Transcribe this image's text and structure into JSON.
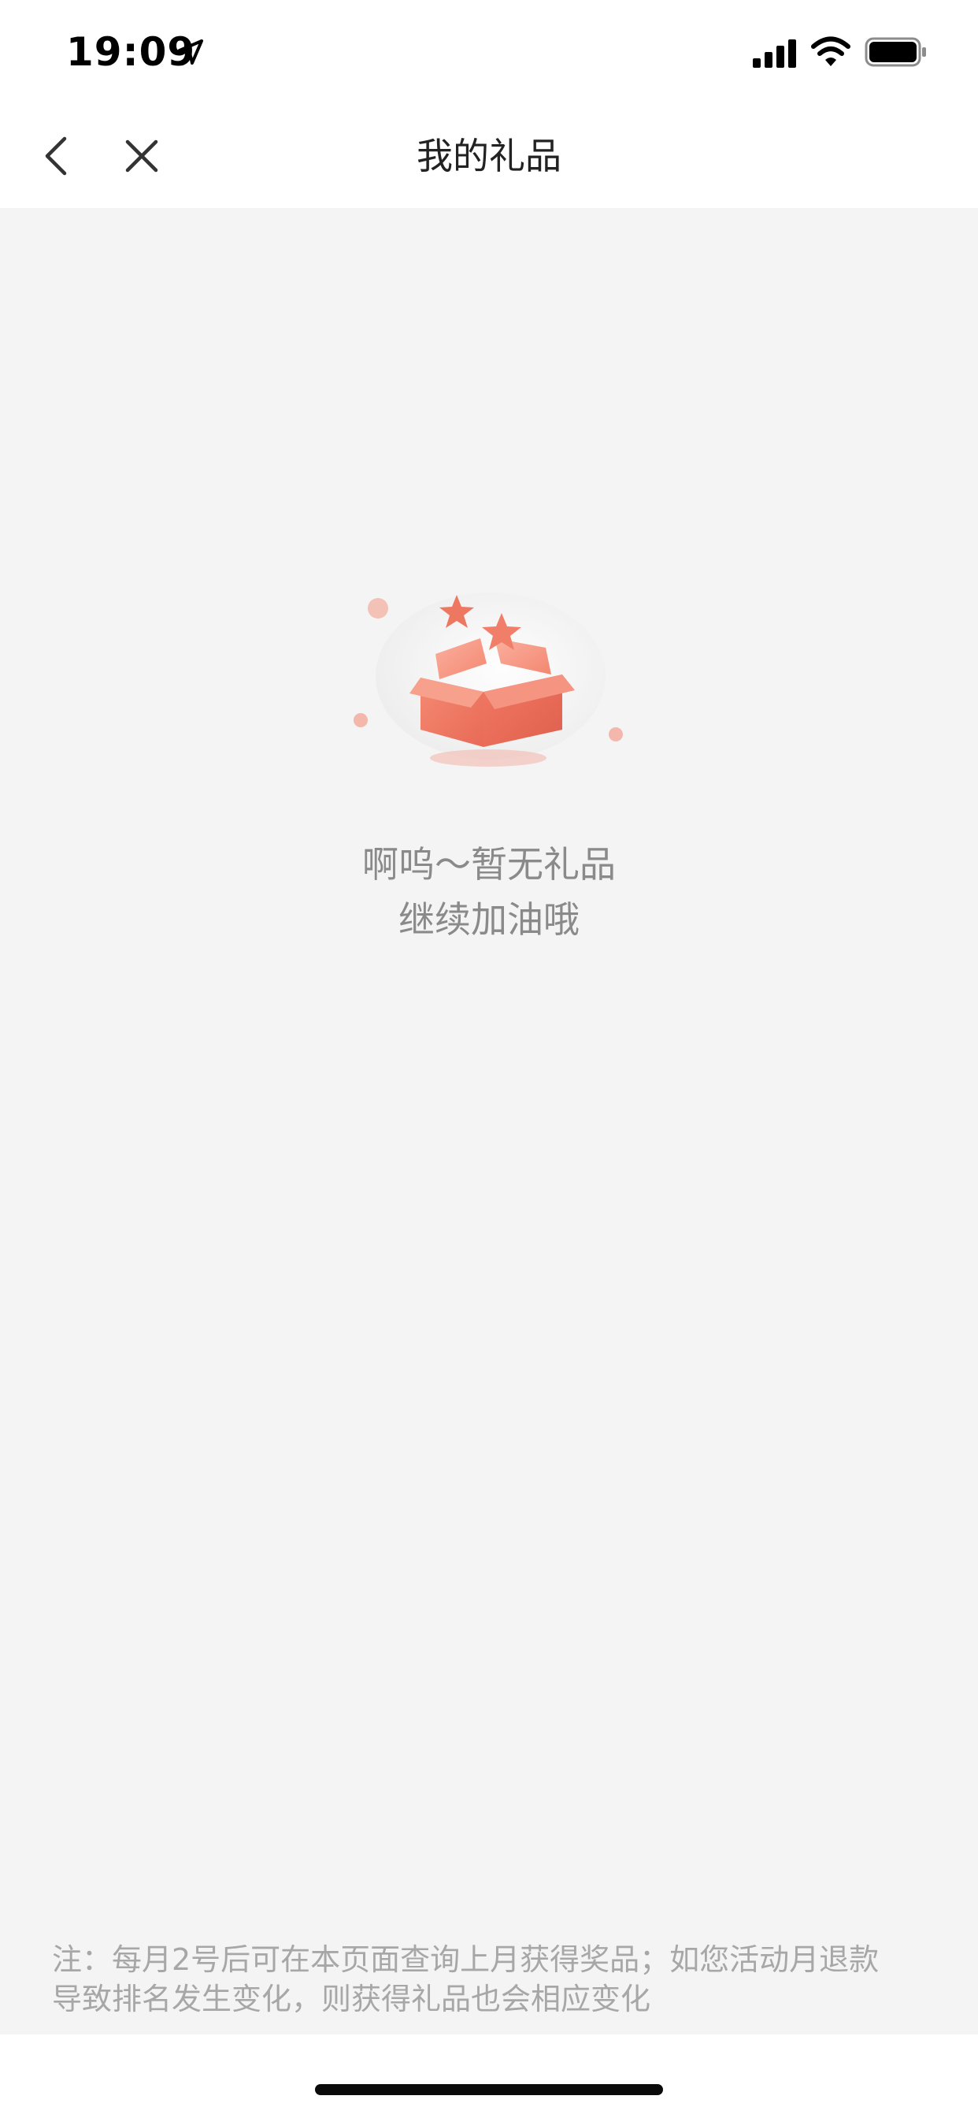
{
  "status_bar": {
    "time": "19:09",
    "icons": [
      "location-arrow-icon",
      "cellular-signal-icon",
      "wifi-icon",
      "battery-icon"
    ]
  },
  "nav": {
    "title": "我的礼品",
    "back_icon": "chevron-left-icon",
    "close_icon": "close-icon"
  },
  "empty_state": {
    "illustration": "gift-box-icon",
    "line1": "啊呜～暂无礼品",
    "line2": "继续加油哦"
  },
  "footer": {
    "note_line1": "注：每月2号后可在本页面查询上月获得奖品；如您活动月退款",
    "note_line2": "导致排名发生变化，则获得礼品也会相应变化"
  },
  "colors": {
    "background": "#f4f4f4",
    "accent": "#ef7b68",
    "text_muted": "#8a8a8a"
  }
}
